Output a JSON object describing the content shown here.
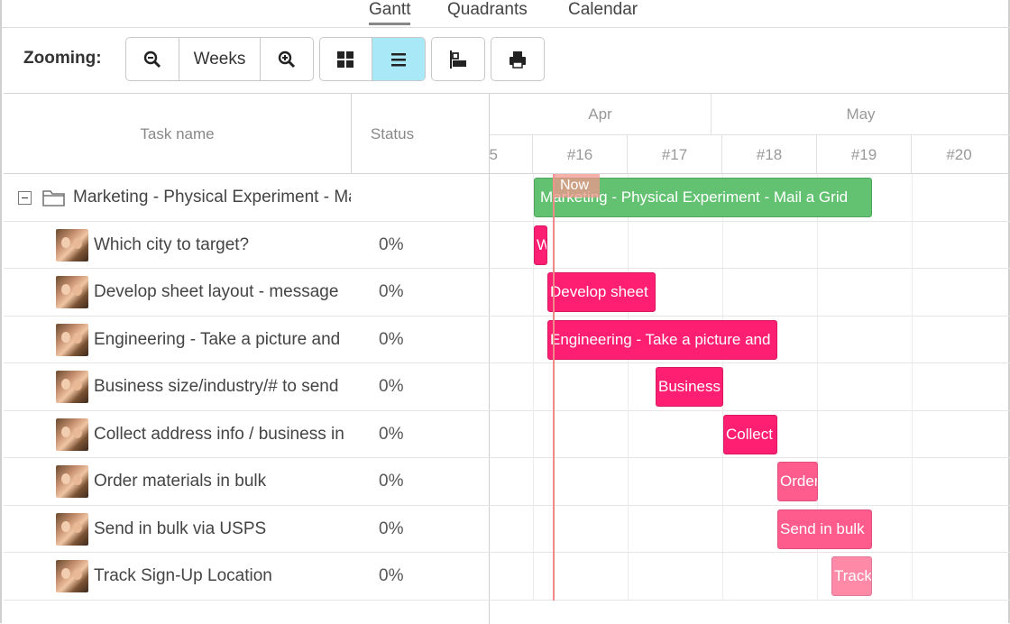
{
  "view_tabs": [
    {
      "label": "Gantt"
    },
    {
      "label": "Quadrants"
    },
    {
      "label": "Calendar"
    }
  ],
  "toolbar": {
    "zoom_label": "Zooming:",
    "zoom_level": "Weeks",
    "icons": [
      "zoom-out-icon",
      "zoom-in-icon",
      "grid-view-icon",
      "list-view-icon",
      "gantt-view-icon",
      "print-icon"
    ]
  },
  "columns": {
    "task_name": "Task name",
    "status": "Status"
  },
  "timeline": {
    "months": [
      "Apr",
      "May"
    ],
    "weeks": [
      "5",
      "#16",
      "#17",
      "#18",
      "#19",
      "#20"
    ],
    "now_label": "Now"
  },
  "rows": [
    {
      "name": "Marketing - Physical Experiment - Mail a Grid",
      "status": "",
      "bar_label": "Marketing - Physical Experiment - Mail a Grid"
    },
    {
      "name": "Which city to target?",
      "status": "0%",
      "bar_label": "W"
    },
    {
      "name": "Develop sheet layout - message",
      "status": "0%",
      "bar_label": "Develop sheet"
    },
    {
      "name": "Engineering - Take a picture and",
      "status": "0%",
      "bar_label": "Engineering - Take a picture and"
    },
    {
      "name": "Business size/industry/# to send",
      "status": "0%",
      "bar_label": "Business"
    },
    {
      "name": "Collect address info / business in",
      "status": "0%",
      "bar_label": "Collect"
    },
    {
      "name": "Order materials in bulk",
      "status": "0%",
      "bar_label": "Order"
    },
    {
      "name": "Send in bulk via USPS",
      "status": "0%",
      "bar_label": "Send in bulk"
    },
    {
      "name": "Track Sign-Up Location",
      "status": "0%",
      "bar_label": "Track"
    }
  ],
  "colors": {
    "summary_bar": "#63c271",
    "task_bar": "#ff1f72",
    "now_line": "#f08a8a",
    "active_button": "#a9e8f7"
  }
}
